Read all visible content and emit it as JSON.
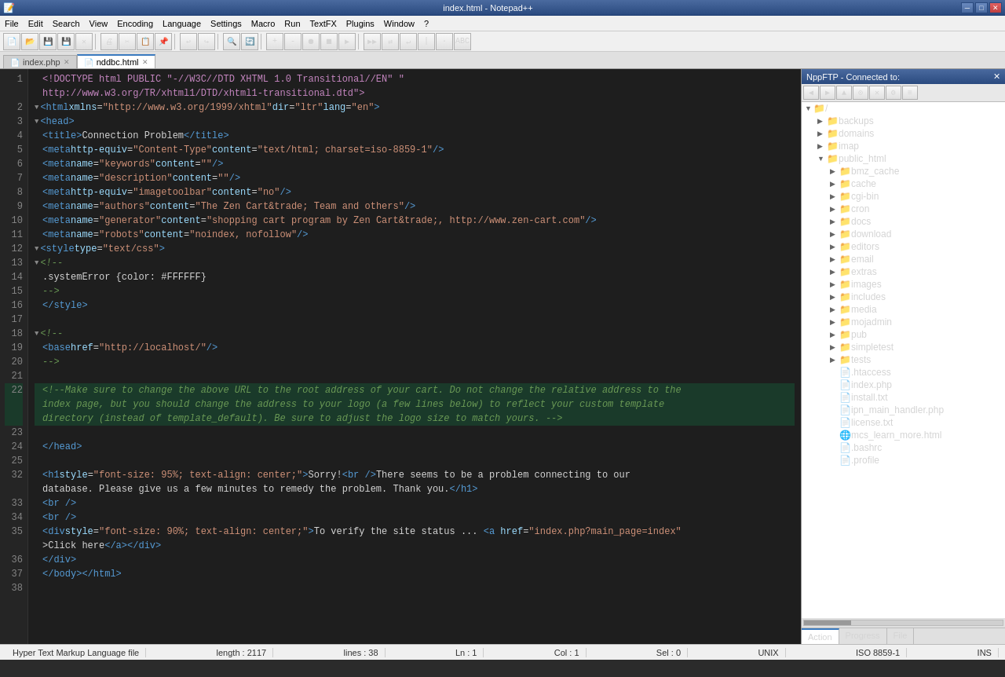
{
  "window": {
    "title": "index.html - Notepad++",
    "titlebar_text": "index.html - Notepad++"
  },
  "menu": {
    "items": [
      "File",
      "Edit",
      "Search",
      "View",
      "Encoding",
      "Language",
      "Settings",
      "Macro",
      "Run",
      "TextFX",
      "Plugins",
      "Window",
      "?"
    ]
  },
  "tabs": [
    {
      "label": "index.php",
      "active": false
    },
    {
      "label": "nddbc.html",
      "active": true
    }
  ],
  "editor": {
    "lines": [
      {
        "num": 1,
        "fold": "",
        "content": "<!DOCTYPE html PUBLIC \"-//W3C//DTD XHTML 1.0 Transitional//EN\" \"",
        "highlight": false
      },
      {
        "num": "",
        "fold": "",
        "content": "    http://www.w3.org/TR/xhtml1/DTD/xhtml1-transitional.dtd\">",
        "highlight": false
      },
      {
        "num": 2,
        "fold": "▼",
        "content": "<html xmlns=\"http://www.w3.org/1999/xhtml\" dir=\"ltr\" lang=\"en\">",
        "highlight": false
      },
      {
        "num": 3,
        "fold": "▼",
        "content": "<head>",
        "highlight": false
      },
      {
        "num": 4,
        "fold": "",
        "content": "    <title>Connection Problem</title>",
        "highlight": false
      },
      {
        "num": 5,
        "fold": "",
        "content": "    <meta http-equiv=\"Content-Type\" content=\"text/html; charset=iso-8859-1\" />",
        "highlight": false
      },
      {
        "num": 6,
        "fold": "",
        "content": "    <meta name=\"keywords\" content=\"\" />",
        "highlight": false
      },
      {
        "num": 7,
        "fold": "",
        "content": "    <meta name=\"description\" content=\"\" />",
        "highlight": false
      },
      {
        "num": 8,
        "fold": "",
        "content": "    <meta http-equiv=\"imagetoolbar\" content=\"no\" />",
        "highlight": false
      },
      {
        "num": 9,
        "fold": "",
        "content": "    <meta name=\"authors\" content=\"The Zen Cart&trade; Team and others\" />",
        "highlight": false
      },
      {
        "num": 10,
        "fold": "",
        "content": "    <meta name=\"generator\" content=\"shopping cart program by Zen Cart&trade;, http://www.zen-cart.com\" />",
        "highlight": false
      },
      {
        "num": 11,
        "fold": "",
        "content": "    <meta name=\"robots\" content=\"noindex, nofollow\" />",
        "highlight": false
      },
      {
        "num": 12,
        "fold": "▼",
        "content": "    <style type=\"text/css\">",
        "highlight": false
      },
      {
        "num": 13,
        "fold": "▼",
        "content": "    <!--",
        "highlight": false
      },
      {
        "num": 14,
        "fold": "",
        "content": "        .systemError {color: #FFFFFF}",
        "highlight": false
      },
      {
        "num": 15,
        "fold": "",
        "content": "    -->",
        "highlight": false
      },
      {
        "num": 16,
        "fold": "",
        "content": "    </style>",
        "highlight": false
      },
      {
        "num": 17,
        "fold": "",
        "content": "",
        "highlight": false
      },
      {
        "num": 18,
        "fold": "▼",
        "content": "    <!--",
        "highlight": false
      },
      {
        "num": 19,
        "fold": "",
        "content": "    <base href=\"http://localhost/\" />",
        "highlight": false
      },
      {
        "num": 20,
        "fold": "",
        "content": "    -->",
        "highlight": false
      },
      {
        "num": 21,
        "fold": "",
        "content": "",
        "highlight": false
      },
      {
        "num": 22,
        "fold": "",
        "content": "    <!--Make sure to change the above URL to the root address of your cart. Do not change the relative address to the",
        "highlight": true
      },
      {
        "num": "",
        "fold": "",
        "content": "    index page, but you should change the address to your logo (a few lines below) to reflect your custom template",
        "highlight": true
      },
      {
        "num": "",
        "fold": "",
        "content": "    directory (instead of template_default). Be sure to adjust the logo size to match yours. -->",
        "highlight": true
      },
      {
        "num": 23,
        "fold": "",
        "content": "",
        "highlight": false
      },
      {
        "num": 24,
        "fold": "",
        "content": "</head>",
        "highlight": false
      },
      {
        "num": 25,
        "fold": "",
        "content": "",
        "highlight": false
      },
      {
        "num": 32,
        "fold": "",
        "content": "    <h1 style=\"font-size: 95%; text-align: center;\">Sorry!<br />There seems to be a problem connecting to our",
        "highlight": false
      },
      {
        "num": "",
        "fold": "",
        "content": "    database. Please give us a few minutes to remedy the problem. Thank you.</h1>",
        "highlight": false
      },
      {
        "num": 33,
        "fold": "",
        "content": "    <br />",
        "highlight": false
      },
      {
        "num": 34,
        "fold": "",
        "content": "    <br />",
        "highlight": false
      },
      {
        "num": 35,
        "fold": "",
        "content": "    <div style=\"font-size: 90%; text-align: center;\">To verify the site status ... <a href=\"index.php?main_page=index\"",
        "highlight": false
      },
      {
        "num": "",
        "fold": "",
        "content": "    >Click here</a></div>",
        "highlight": false
      },
      {
        "num": 36,
        "fold": "",
        "content": "    </div>",
        "highlight": false
      },
      {
        "num": 37,
        "fold": "",
        "content": "    </body></html>",
        "highlight": false
      },
      {
        "num": 38,
        "fold": "",
        "content": "",
        "highlight": false
      }
    ]
  },
  "sidebar": {
    "header": "NppFTP - Connected to:",
    "toolbar_buttons": [
      "←",
      "→",
      "↑",
      "⊙",
      "✕",
      "⚙",
      "≡"
    ],
    "tree_root": "/",
    "folders": [
      {
        "name": "backups",
        "indent": 1,
        "type": "folder"
      },
      {
        "name": "domains",
        "indent": 1,
        "type": "folder"
      },
      {
        "name": "imap",
        "indent": 1,
        "type": "folder"
      },
      {
        "name": "public_html",
        "indent": 1,
        "type": "folder",
        "expanded": true
      },
      {
        "name": "bmz_cache",
        "indent": 2,
        "type": "folder"
      },
      {
        "name": "cache",
        "indent": 2,
        "type": "folder",
        "selected": false
      },
      {
        "name": "cgi-bin",
        "indent": 2,
        "type": "folder"
      },
      {
        "name": "cron",
        "indent": 2,
        "type": "folder"
      },
      {
        "name": "docs",
        "indent": 2,
        "type": "folder"
      },
      {
        "name": "download",
        "indent": 2,
        "type": "folder"
      },
      {
        "name": "editors",
        "indent": 2,
        "type": "folder"
      },
      {
        "name": "email",
        "indent": 2,
        "type": "folder"
      },
      {
        "name": "extras",
        "indent": 2,
        "type": "folder"
      },
      {
        "name": "images",
        "indent": 2,
        "type": "folder"
      },
      {
        "name": "includes",
        "indent": 2,
        "type": "folder"
      },
      {
        "name": "media",
        "indent": 2,
        "type": "folder"
      },
      {
        "name": "mojadmin",
        "indent": 2,
        "type": "folder"
      },
      {
        "name": "pub",
        "indent": 2,
        "type": "folder"
      },
      {
        "name": "simpletest",
        "indent": 2,
        "type": "folder"
      },
      {
        "name": "tests",
        "indent": 2,
        "type": "folder"
      },
      {
        "name": ".htaccess",
        "indent": 2,
        "type": "file"
      },
      {
        "name": "index.php",
        "indent": 2,
        "type": "file"
      },
      {
        "name": "install.txt",
        "indent": 2,
        "type": "file"
      },
      {
        "name": "ipn_main_handler.php",
        "indent": 2,
        "type": "file"
      },
      {
        "name": "license.txt",
        "indent": 2,
        "type": "file"
      },
      {
        "name": "mcs_learn_more.html",
        "indent": 2,
        "type": "file-special"
      },
      {
        "name": ".bashrc",
        "indent": 2,
        "type": "file"
      },
      {
        "name": ".profile",
        "indent": 2,
        "type": "file"
      }
    ],
    "bottom_tabs": [
      "Action",
      "Progress",
      "File"
    ]
  },
  "statusbar": {
    "file_type": "Hyper Text Markup Language file",
    "length": "length : 2117",
    "lines": "lines : 38",
    "ln": "Ln : 1",
    "col": "Col : 1",
    "sel": "Sel : 0",
    "unix": "UNIX",
    "encoding": "ISO 8859-1",
    "ins": "INS"
  }
}
